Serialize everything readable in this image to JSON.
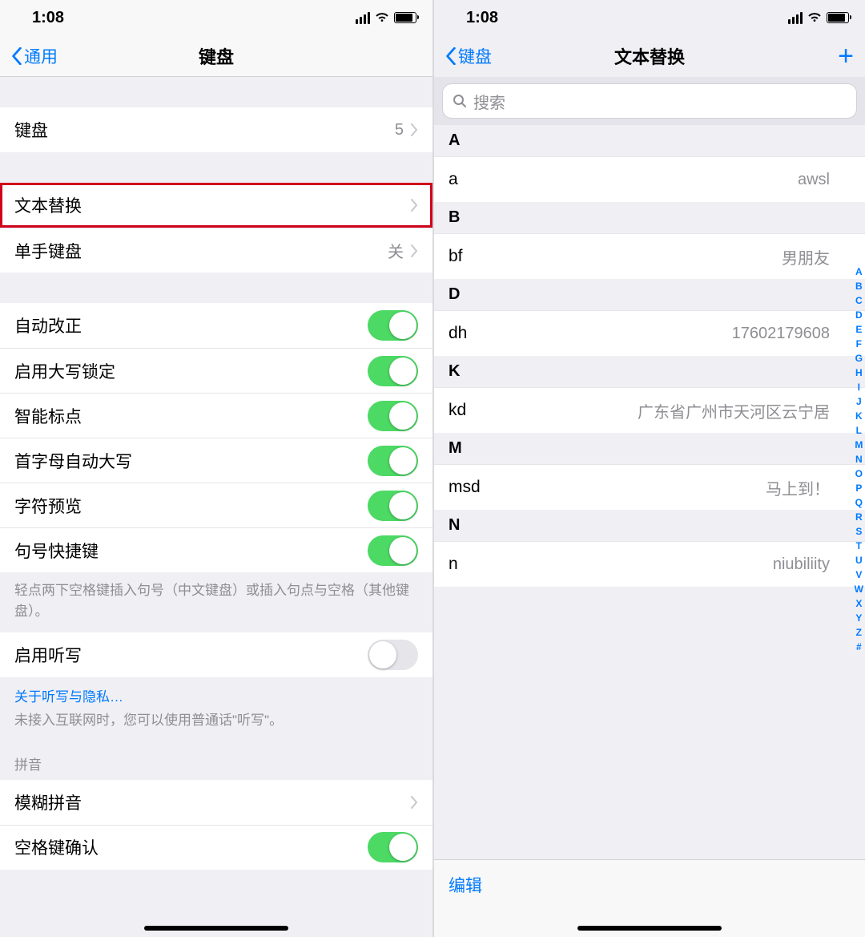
{
  "left": {
    "status_time": "1:08",
    "back": "通用",
    "title": "键盘",
    "rows": {
      "keyboards": {
        "label": "键盘",
        "value": "5"
      },
      "text_replace": {
        "label": "文本替换"
      },
      "one_hand": {
        "label": "单手键盘",
        "value": "关"
      },
      "auto_correct": {
        "label": "自动改正",
        "on": true
      },
      "caps_lock": {
        "label": "启用大写锁定",
        "on": true
      },
      "smart_punct": {
        "label": "智能标点",
        "on": true
      },
      "auto_cap": {
        "label": "首字母自动大写",
        "on": true
      },
      "char_preview": {
        "label": "字符预览",
        "on": true
      },
      "period": {
        "label": "句号快捷键",
        "on": true
      },
      "dictation": {
        "label": "启用听写",
        "on": false
      },
      "fuzzy": {
        "label": "模糊拼音"
      },
      "space_confirm": {
        "label": "空格键确认",
        "on": true
      }
    },
    "period_note": "轻点两下空格键插入句号（中文键盘）或插入句点与空格（其他键盘）。",
    "dictation_link": "关于听写与隐私…",
    "dictation_note": "未接入互联网时，您可以使用普通话\"听写\"。",
    "pinyin_header": "拼音"
  },
  "right": {
    "status_time": "1:08",
    "back": "键盘",
    "title": "文本替换",
    "search_placeholder": "搜索",
    "sections": [
      {
        "letter": "A",
        "items": [
          {
            "key": "a",
            "val": "awsl"
          }
        ]
      },
      {
        "letter": "B",
        "items": [
          {
            "key": "bf",
            "val": "男朋友"
          }
        ]
      },
      {
        "letter": "D",
        "items": [
          {
            "key": "dh",
            "val": "17602179608"
          }
        ]
      },
      {
        "letter": "K",
        "items": [
          {
            "key": "kd",
            "val": "广东省广州市天河区云宁居"
          }
        ]
      },
      {
        "letter": "M",
        "items": [
          {
            "key": "msd",
            "val": "马上到！"
          }
        ]
      },
      {
        "letter": "N",
        "items": [
          {
            "key": "n",
            "val": "niubiliity"
          }
        ]
      }
    ],
    "index": [
      "A",
      "B",
      "C",
      "D",
      "E",
      "F",
      "G",
      "H",
      "I",
      "J",
      "K",
      "L",
      "M",
      "N",
      "O",
      "P",
      "Q",
      "R",
      "S",
      "T",
      "U",
      "V",
      "W",
      "X",
      "Y",
      "Z",
      "#"
    ],
    "edit": "编辑"
  }
}
